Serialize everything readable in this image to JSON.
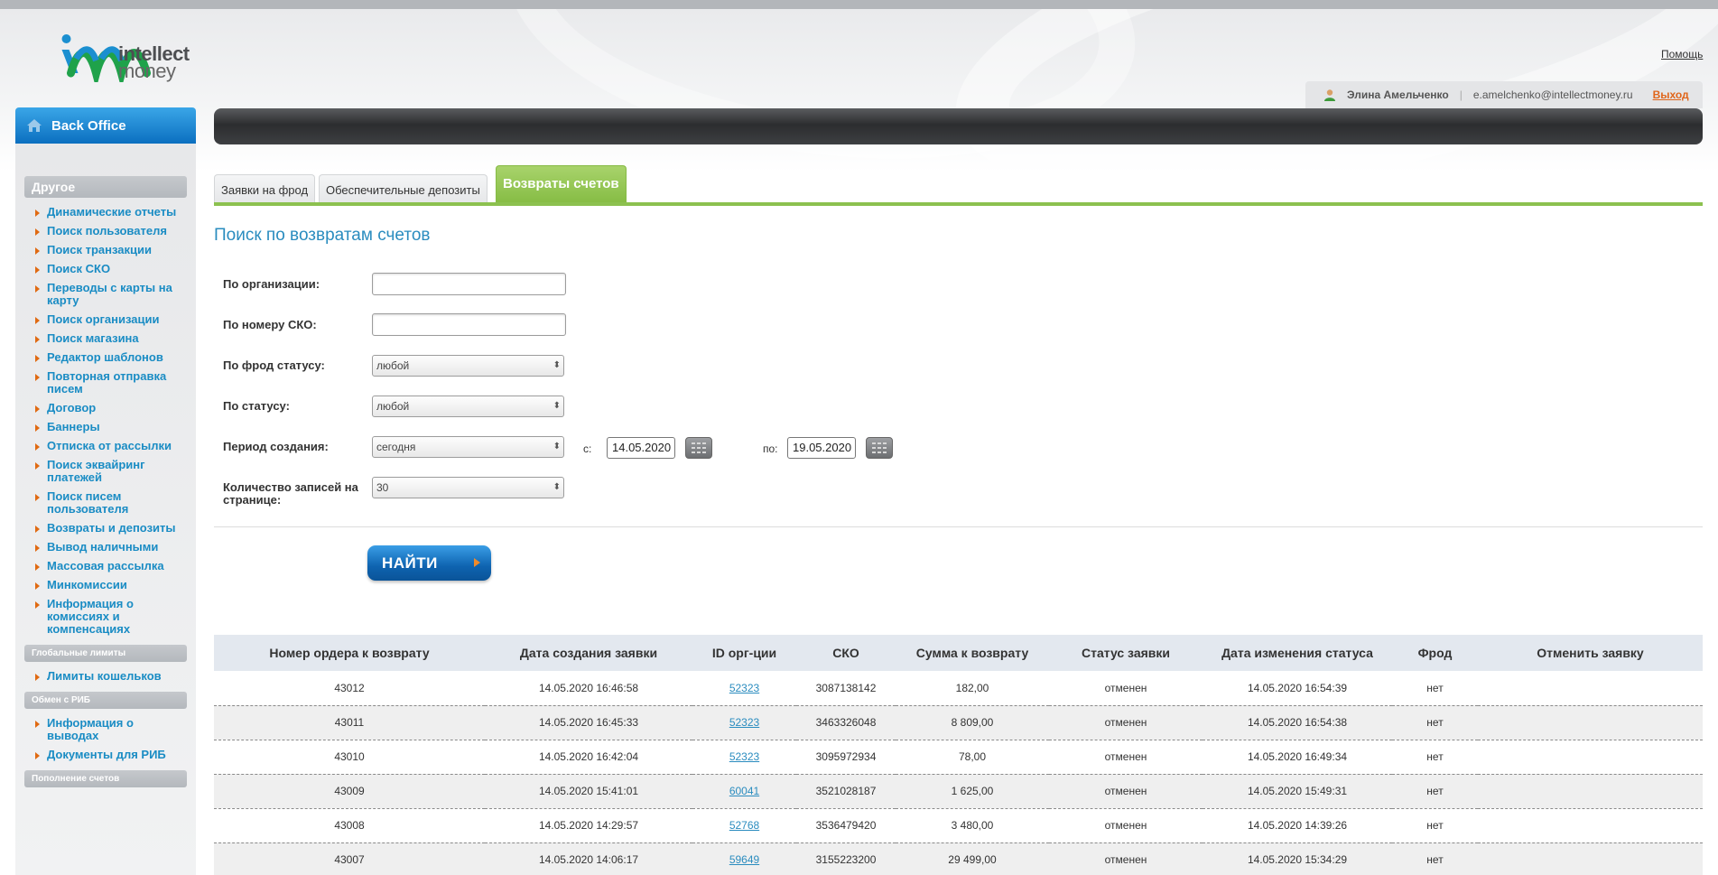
{
  "header": {
    "logo_line1": "intellect",
    "logo_line2": "money",
    "help_link": "Помощь",
    "user_name": "Элина Амельченко",
    "user_email": "e.amelchenko@intellectmoney.ru",
    "logout": "Выход"
  },
  "sidebar": {
    "title": "Back Office",
    "sections": [
      {
        "title": "Другое",
        "items": [
          "Динамические отчеты",
          "Поиск пользователя",
          "Поиск транзакции",
          "Поиск СКО",
          "Переводы с карты на карту",
          "Поиск организации",
          "Поиск магазина",
          "Редактор шаблонов",
          "Повторная отправка писем",
          "Договор",
          "Баннеры",
          "Отписка от рассылки",
          "Поиск эквайринг платежей",
          "Поиск писем пользователя",
          "Возвраты и депозиты",
          "Вывод наличными",
          "Массовая рассылка",
          "Минкомиссии",
          "Информация о комиссиях и компенсациях"
        ]
      },
      {
        "title": "Глобальные лимиты",
        "items": [
          "Лимиты кошельков"
        ]
      },
      {
        "title": "Обмен с РИБ",
        "items": [
          "Информация о выводах",
          "Документы для РИБ"
        ]
      },
      {
        "title": "Пополнение счетов",
        "items": []
      }
    ]
  },
  "tabs": [
    {
      "label": "Заявки на фрод",
      "active": false
    },
    {
      "label": "Обеспечительные депозиты",
      "active": false
    },
    {
      "label": "Возвраты счетов",
      "active": true
    }
  ],
  "page_title": "Поиск по возвратам счетов",
  "form": {
    "org_label": "По организации:",
    "org_value": "",
    "sko_label": "По номеру СКО:",
    "sko_value": "",
    "fraud_status_label": "По фрод статусу:",
    "fraud_status_value": "любой",
    "status_label": "По статусу:",
    "status_value": "любой",
    "period_label": "Период создания:",
    "period_value": "сегодня",
    "from_label": "с:",
    "from_date": "14.05.2020",
    "to_label": "по:",
    "to_date": "19.05.2020",
    "per_page_label": "Количество записей на странице:",
    "per_page_value": "30",
    "find_button": "НАЙТИ"
  },
  "table": {
    "headers": [
      "Номер ордера к возврату",
      "Дата создания заявки",
      "ID орг-ции",
      "СКО",
      "Сумма к возврату",
      "Статус заявки",
      "Дата изменения статуса",
      "Фрод",
      "Отменить заявку"
    ],
    "rows": [
      [
        "43012",
        "14.05.2020 16:46:58",
        "52323",
        "3087138142",
        "182,00",
        "отменен",
        "14.05.2020 16:54:39",
        "нет",
        ""
      ],
      [
        "43011",
        "14.05.2020 16:45:33",
        "52323",
        "3463326048",
        "8 809,00",
        "отменен",
        "14.05.2020 16:54:38",
        "нет",
        ""
      ],
      [
        "43010",
        "14.05.2020 16:42:04",
        "52323",
        "3095972934",
        "78,00",
        "отменен",
        "14.05.2020 16:49:34",
        "нет",
        ""
      ],
      [
        "43009",
        "14.05.2020 15:41:01",
        "60041",
        "3521028187",
        "1 625,00",
        "отменен",
        "14.05.2020 15:49:31",
        "нет",
        ""
      ],
      [
        "43008",
        "14.05.2020 14:29:57",
        "52768",
        "3536479420",
        "3 480,00",
        "отменен",
        "14.05.2020 14:39:26",
        "нет",
        ""
      ],
      [
        "43007",
        "14.05.2020 14:06:17",
        "59649",
        "3155223200",
        "29 499,00",
        "отменен",
        "14.05.2020 15:34:29",
        "нет",
        ""
      ]
    ]
  },
  "colors": {
    "accent_blue": "#1a8cc4",
    "tab_green": "#8cc14f",
    "nav_arrow": "#e06a12"
  }
}
